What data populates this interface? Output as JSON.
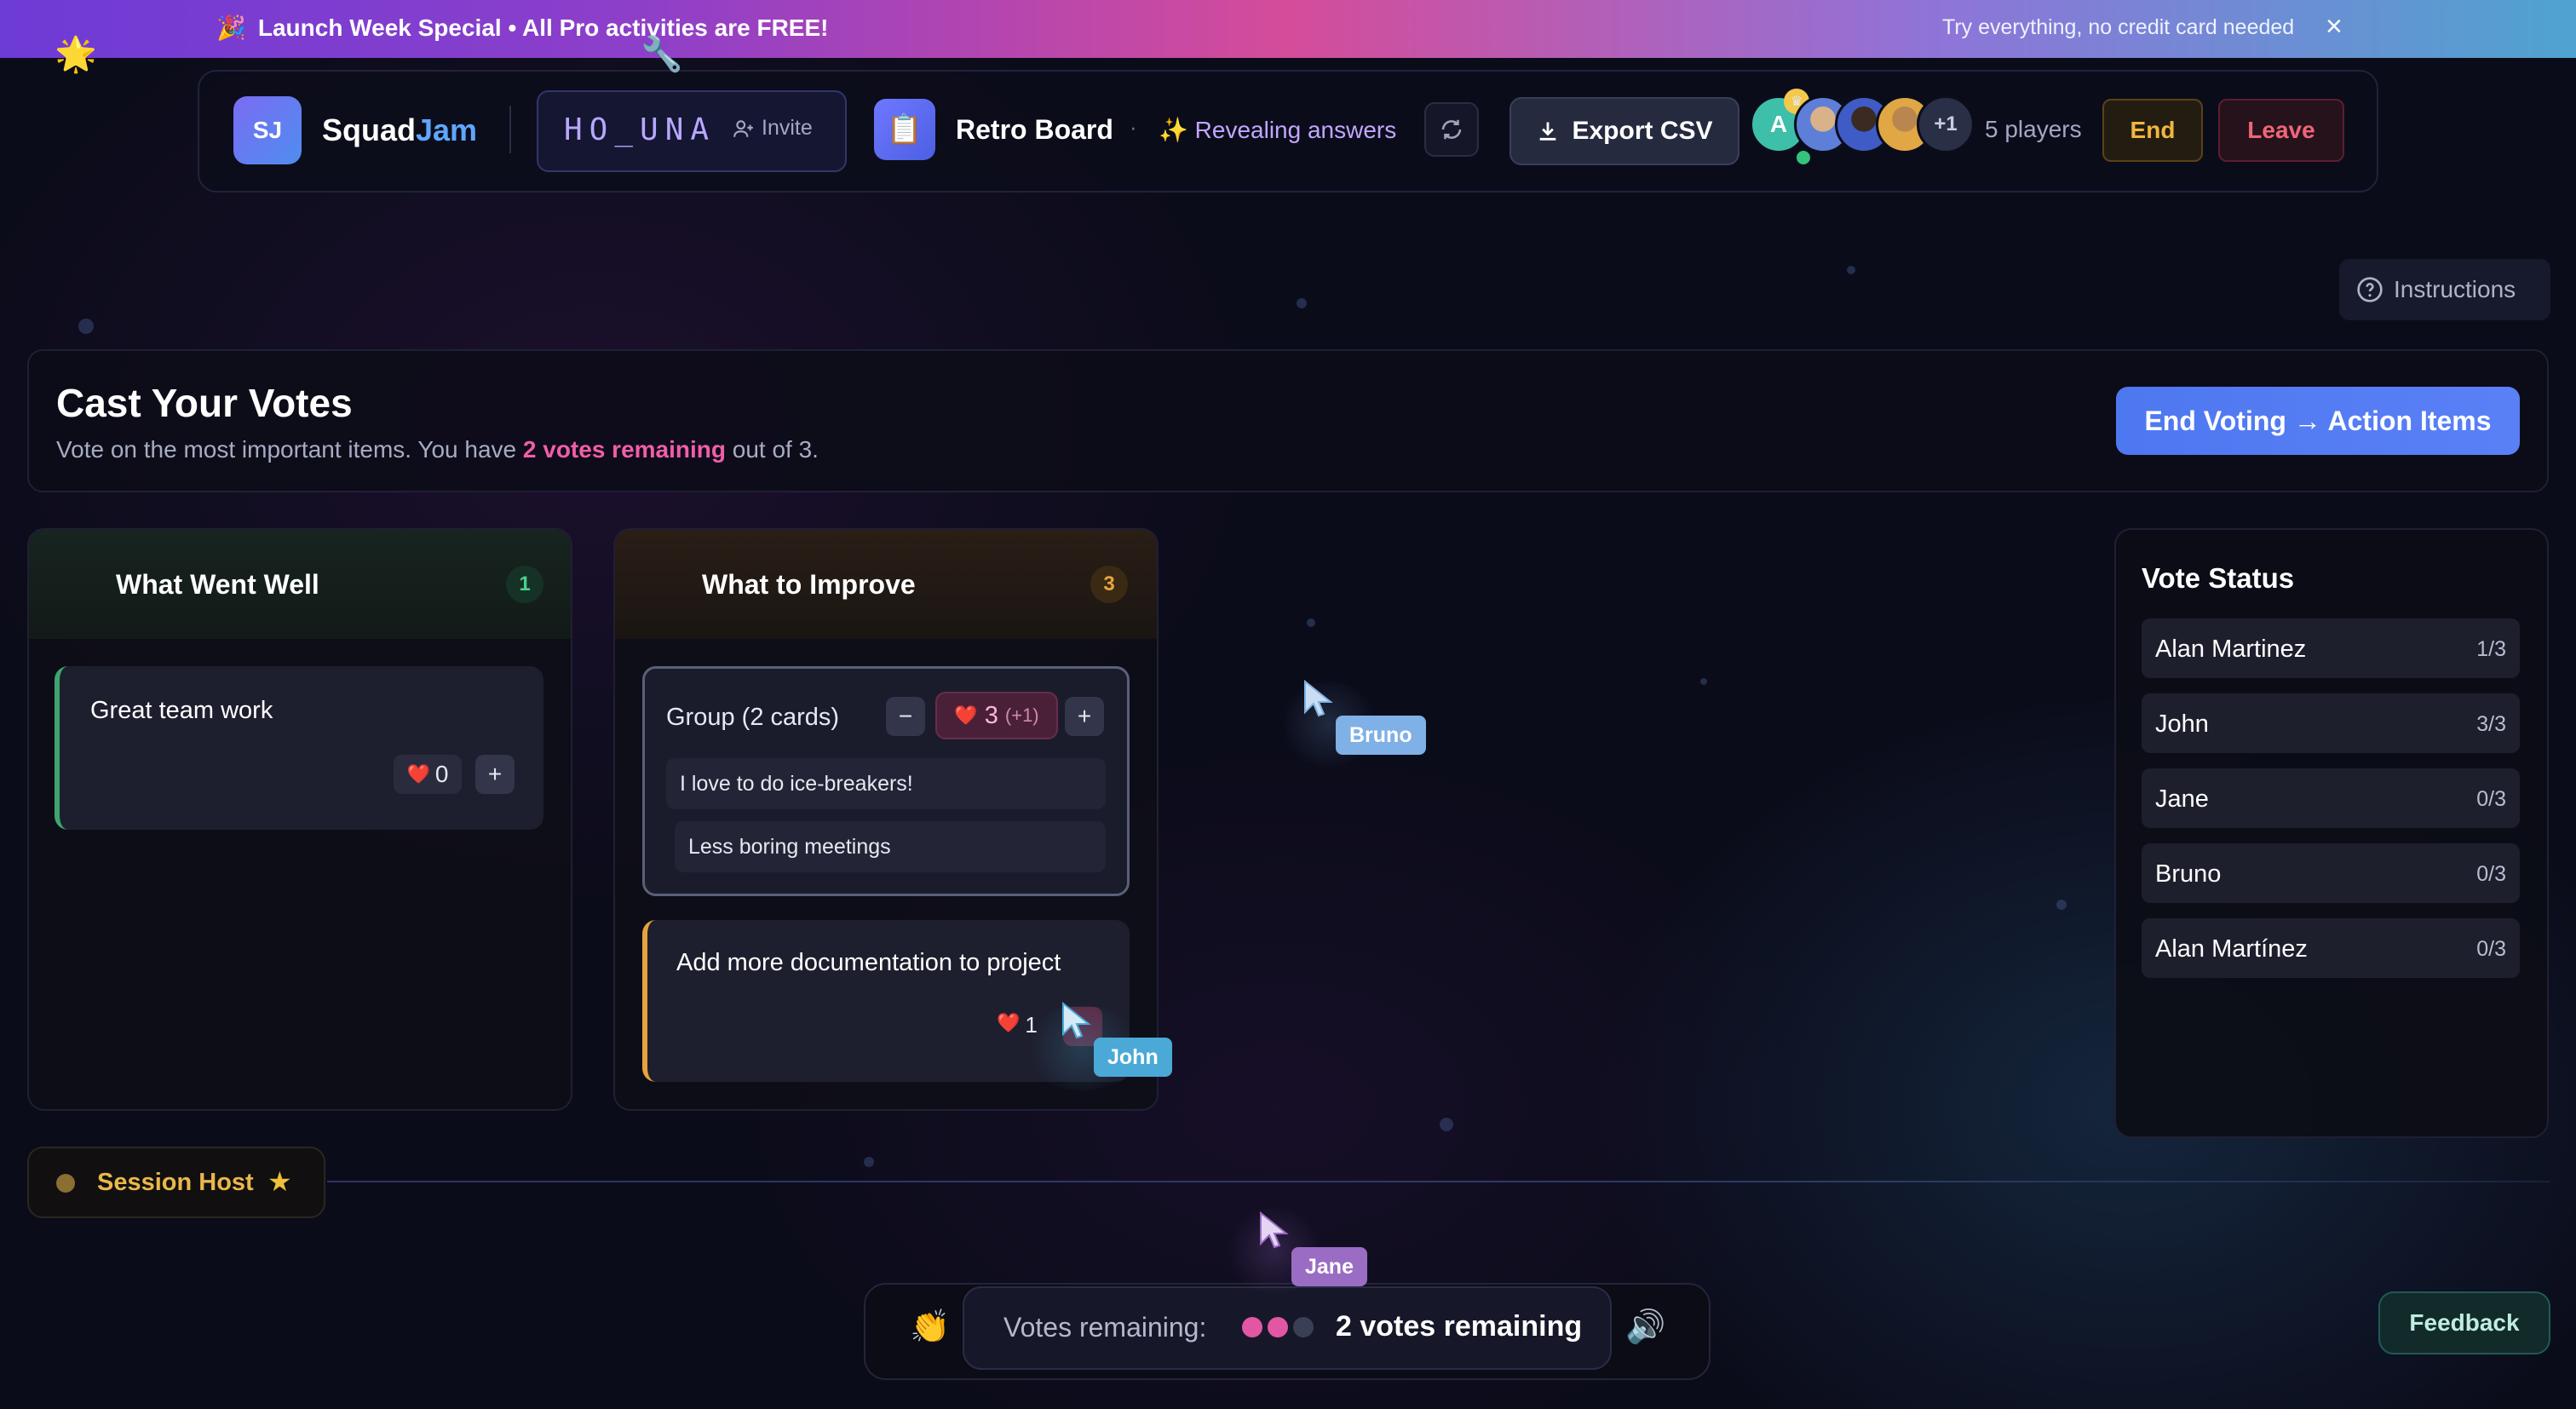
{
  "banner": {
    "emoji": "🎉",
    "text": "Launch Week Special • All Pro activities are FREE!",
    "right_text": "Try everything, no credit card needed",
    "close": "×"
  },
  "header": {
    "logo_initials": "SJ",
    "brand_part1": "Squad",
    "brand_part2": "Jam",
    "room_code": "HO_UNA",
    "invite_label": "Invite",
    "board_icon": "📋",
    "board_title": "Retro Board",
    "separator": "·",
    "phase_icon": "✨",
    "phase_text": "Revealing answers",
    "export_label": "Export CSV",
    "avatar_initial": "A",
    "more_players": "+1",
    "players_count": "5 players",
    "end_label": "End",
    "leave_label": "Leave"
  },
  "instructions_label": "Instructions",
  "voting": {
    "title": "Cast Your Votes",
    "sub_prefix": "Vote on the most important items. You have ",
    "sub_highlight": "2 votes remaining",
    "sub_suffix": " out of 3.",
    "end_voting_label": "End Voting → Action Items"
  },
  "columns": [
    {
      "icon": "🌟",
      "title": "What Went Well",
      "count": "1",
      "cards": [
        {
          "text": "Great team work",
          "heart": "❤️",
          "votes": "0",
          "plus": "+"
        }
      ]
    },
    {
      "icon": "🔧",
      "title": "What to Improve",
      "count": "3",
      "group": {
        "title": "Group (2 cards)",
        "minus": "−",
        "heart": "❤️",
        "votes": "3",
        "mine": "(+1)",
        "plus": "+",
        "items": [
          "I love to do ice-breakers!",
          "Less boring meetings"
        ]
      },
      "cards": [
        {
          "text": "Add more documentation to project",
          "heart": "❤️",
          "votes": "1"
        }
      ]
    }
  ],
  "vote_status": {
    "title": "Vote Status",
    "rows": [
      {
        "name": "Alan Martinez",
        "count": "1/3"
      },
      {
        "name": "John",
        "count": "3/3"
      },
      {
        "name": "Jane",
        "count": "0/3"
      },
      {
        "name": "Bruno",
        "count": "0/3"
      },
      {
        "name": "Alan Martínez",
        "count": "0/3"
      }
    ]
  },
  "session_host": {
    "label": "Session Host",
    "star": "★"
  },
  "bottom_bar": {
    "clap_icon": "👏",
    "votes_label": "Votes remaining:",
    "votes_text": "2 votes remaining",
    "votes_used": 1,
    "votes_total": 3,
    "speaker_icon": "🔊"
  },
  "feedback_label": "Feedback",
  "cursors": [
    {
      "name": "Bruno",
      "color": "#7fb0e6"
    },
    {
      "name": "John",
      "color": "#4aa9d6"
    },
    {
      "name": "Jane",
      "color": "#9a6cc4"
    }
  ],
  "colors": {
    "accent_pink": "#f05ea8",
    "accent_blue": "#5a80f6",
    "green_border": "#3ea56e",
    "orange_border": "#e8a23c"
  }
}
